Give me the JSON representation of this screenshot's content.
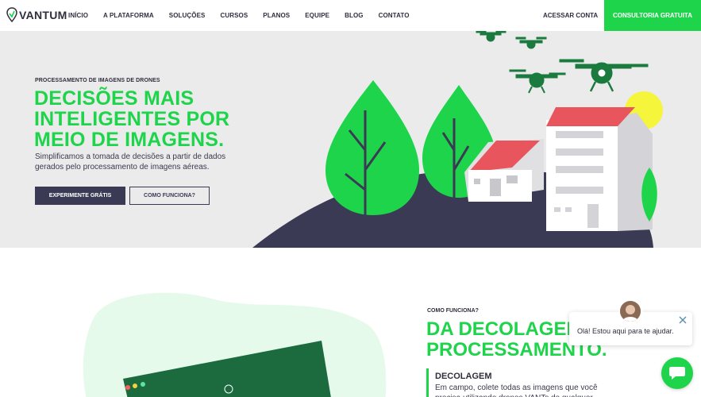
{
  "nav": {
    "logo_text": "VANTUM",
    "menu": [
      "INÍCIO",
      "A PLATAFORMA",
      "SOLUÇÕES",
      "CURSOS",
      "PLANOS",
      "EQUIPE",
      "BLOG",
      "CONTATO"
    ],
    "login": "ACESSAR CONTA",
    "cta": "CONSULTORIA GRATUITA"
  },
  "hero": {
    "eyebrow": "PROCESSAMENTO DE IMAGENS DE DRONES",
    "headline": "DECISÕES MAIS INTELIGENTES POR MEIO DE IMAGENS.",
    "subtitle": "Simplificamos a tomada de decisões a partir de dados gerados pelo processamento de imagens aéreas.",
    "primary_button": "EXPERIMENTE GRÁTIS",
    "secondary_button": "COMO FUNCIONA?"
  },
  "how": {
    "eyebrow": "COMO FUNCIONA?",
    "title_line1": "DA DECOLAGEM",
    "title_line2": "PROCESSAMENTO.",
    "step_title": "DECOLAGEM",
    "step_text": "Em campo, colete todas as imagens que você precisa utilizando drones VANTs de qualquer fabricante."
  },
  "chat": {
    "message": "Olá! Estou aqui para te ajudar."
  },
  "colors": {
    "brand_green": "#1ed44a",
    "dark": "#3b3a55",
    "hero_bg": "#ebebec"
  }
}
